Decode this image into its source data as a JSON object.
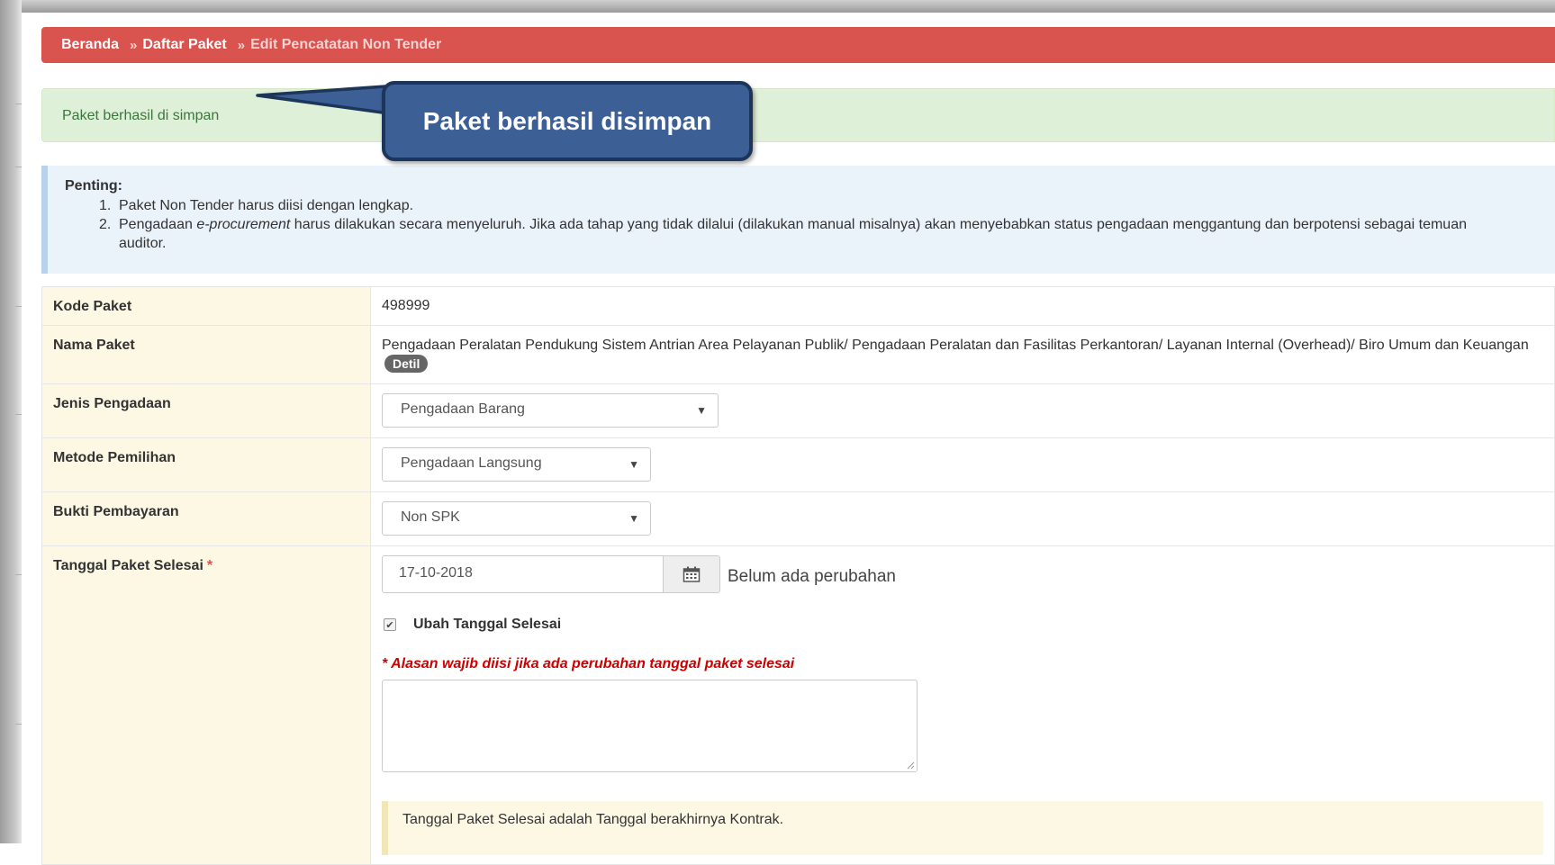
{
  "breadcrumb": {
    "items": [
      "Beranda",
      "Daftar Paket"
    ],
    "current": "Edit Pencatatan Non Tender",
    "separator": "»"
  },
  "alert_success": {
    "text": "Paket berhasil di simpan"
  },
  "callout": {
    "text": "Paket berhasil disimpan"
  },
  "info": {
    "title": "Penting:",
    "items": [
      {
        "num": "1.",
        "text": "Paket Non Tender harus diisi dengan lengkap."
      },
      {
        "num": "2.",
        "text_before": "Pengadaan ",
        "text_em": "e-procurement",
        "text_after": " harus dilakukan secara menyeluruh. Jika ada tahap yang tidak dilalui (dilakukan manual misalnya) akan menyebabkan status pengadaan menggantung dan berpotensi sebagai temuan auditor."
      }
    ]
  },
  "form": {
    "kode_paket": {
      "label": "Kode Paket",
      "value": "498999"
    },
    "nama_paket": {
      "label": "Nama Paket",
      "value": "Pengadaan Peralatan Pendukung Sistem Antrian Area Pelayanan Publik/ Pengadaan Peralatan dan Fasilitas Perkantoran/ Layanan Internal (Overhead)/ Biro Umum dan Keuangan",
      "badge": "Detil"
    },
    "jenis_pengadaan": {
      "label": "Jenis Pengadaan",
      "value": "Pengadaan Barang"
    },
    "metode_pemilihan": {
      "label": "Metode Pemilihan",
      "value": "Pengadaan Langsung"
    },
    "bukti_pembayaran": {
      "label": "Bukti Pembayaran",
      "value": "Non SPK"
    },
    "tanggal": {
      "label": "Tanggal Paket Selesai",
      "required_mark": "*",
      "value": "17-10-2018",
      "status": "Belum ada perubahan",
      "checkbox_label": "Ubah Tanggal Selesai",
      "checkbox_checked": true,
      "warning": "* Alasan wajib diisi jika ada perubahan tanggal paket selesai",
      "reason_value": "",
      "note": "Tanggal Paket Selesai adalah Tanggal berakhirnya Kontrak."
    }
  },
  "icons": {
    "select_caret": "caret-down-icon",
    "date_picker": "calendar-icon",
    "checkbox": "checkmark-icon"
  },
  "colors": {
    "breadcrumb_bg": "#d9534f",
    "success_bg": "#dff0d8",
    "info_bg": "#eaf2fa",
    "label_bg": "#fcf8e3",
    "callout_bg": "#3c5f96",
    "warning_text": "#cc0000"
  }
}
